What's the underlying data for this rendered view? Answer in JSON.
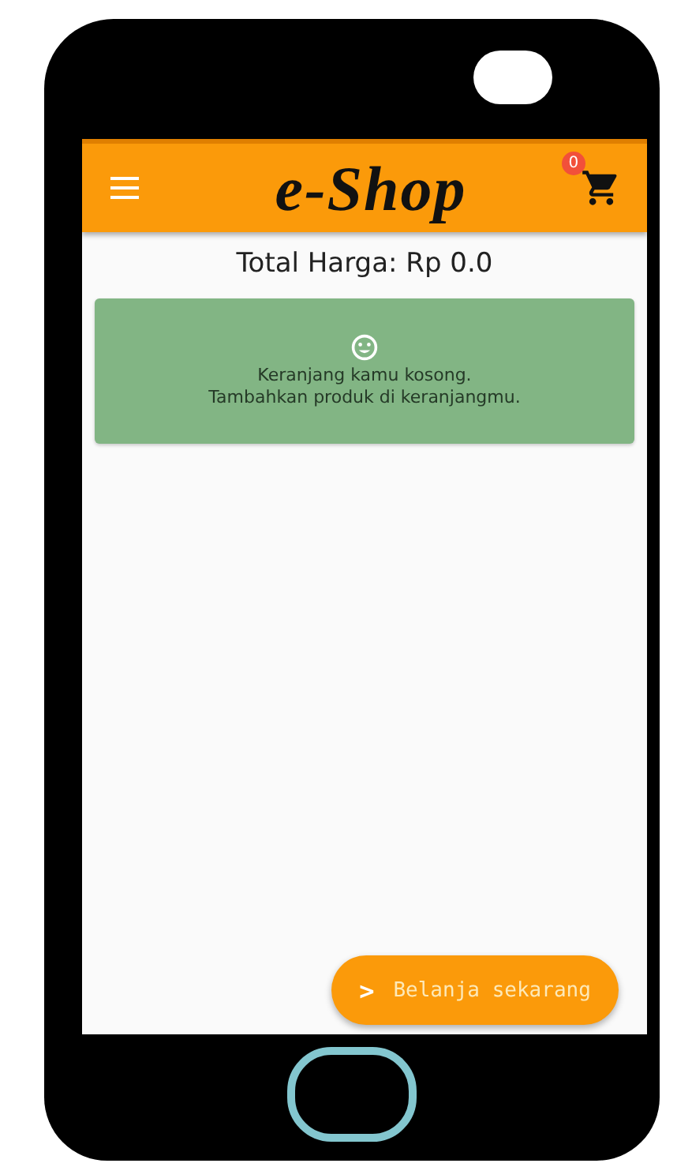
{
  "app_bar": {
    "title": "e-Shop",
    "cart_badge": "0"
  },
  "total": "Total Harga: Rp 0.0",
  "empty_message": {
    "lines": [
      "Keranjang kamu kosong.",
      "Tambahkan produk di keranjangmu."
    ]
  },
  "action_button": {
    "icon": ">",
    "label": "Belanja sekarang"
  }
}
